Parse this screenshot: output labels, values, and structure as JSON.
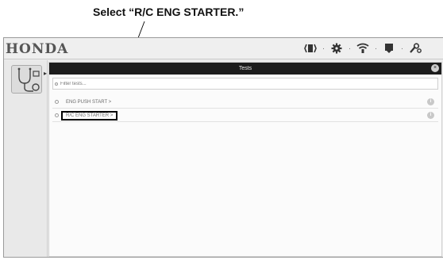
{
  "callout": {
    "text": "Select “R/C ENG STARTER.”"
  },
  "window": {
    "brand": "HONDA",
    "toolbar_icons": [
      "bluetooth-icon",
      "gear-icon",
      "signal-icon",
      "download-icon",
      "tool-icon"
    ],
    "toolbar_separator": "·"
  },
  "panel": {
    "title": "Tests",
    "close": "×",
    "filter_placeholder": "Filter tests...",
    "items": [
      {
        "label": "ENG PUSH START >",
        "info": "i"
      },
      {
        "label": "R/C ENG STARTER >",
        "info": "i"
      }
    ]
  },
  "colors": {
    "header": "#1d1d1d",
    "highlight_border": "#000000"
  }
}
